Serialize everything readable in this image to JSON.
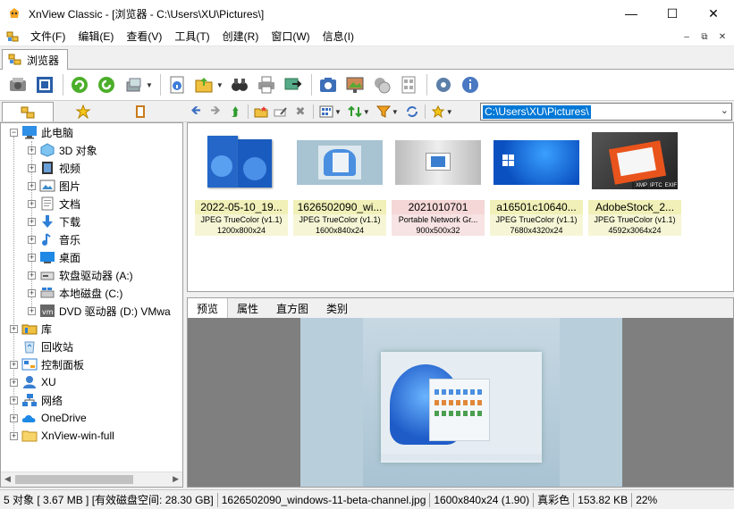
{
  "window": {
    "title": "XnView Classic - [浏览器 - C:\\Users\\XU\\Pictures\\]"
  },
  "menu": {
    "items": [
      "文件(F)",
      "编辑(E)",
      "查看(V)",
      "工具(T)",
      "创建(R)",
      "窗口(W)",
      "信息(I)"
    ]
  },
  "tab": {
    "label": "浏览器"
  },
  "path": {
    "value": "C:\\Users\\XU\\Pictures\\"
  },
  "tree": {
    "items": [
      {
        "label": "此电脑",
        "icon": "computer-icon"
      },
      {
        "label": "3D 对象",
        "icon": "3d-objects-icon"
      },
      {
        "label": "视频",
        "icon": "video-icon"
      },
      {
        "label": "图片",
        "icon": "pictures-icon"
      },
      {
        "label": "文档",
        "icon": "documents-icon"
      },
      {
        "label": "下载",
        "icon": "download-icon"
      },
      {
        "label": "音乐",
        "icon": "music-icon"
      },
      {
        "label": "桌面",
        "icon": "desktop-icon"
      },
      {
        "label": "软盘驱动器 (A:)",
        "icon": "floppy-icon"
      },
      {
        "label": "本地磁盘 (C:)",
        "icon": "disk-icon"
      },
      {
        "label": "DVD 驱动器 (D:) VMwa",
        "icon": "dvd-icon"
      },
      {
        "label": "库",
        "icon": "library-icon"
      },
      {
        "label": "回收站",
        "icon": "recycle-bin-icon"
      },
      {
        "label": "控制面板",
        "icon": "control-panel-icon"
      },
      {
        "label": "XU",
        "icon": "user-icon"
      },
      {
        "label": "网络",
        "icon": "network-icon"
      },
      {
        "label": "OneDrive",
        "icon": "onedrive-icon"
      },
      {
        "label": "XnView-win-full",
        "icon": "folder-icon"
      }
    ]
  },
  "thumbnails": [
    {
      "name": "2022-05-10_19...",
      "type": "JPEG TrueColor (v1.1)",
      "dims": "1200x800x24"
    },
    {
      "name": "1626502090_wi...",
      "type": "JPEG TrueColor (v1.1)",
      "dims": "1600x840x24"
    },
    {
      "name": "2021010701",
      "type": "Portable Network Gr...",
      "dims": "900x500x32"
    },
    {
      "name": "a16501c10640...",
      "type": "JPEG TrueColor (v1.1)",
      "dims": "7680x4320x24"
    },
    {
      "name": "AdobeStock_2...",
      "type": "JPEG TrueColor (v1.1)",
      "dims": "4592x3064x24"
    }
  ],
  "badges": [
    "XMP",
    "IPTC",
    "EXIF"
  ],
  "preview_tabs": [
    "预览",
    "属性",
    "直方图",
    "类别"
  ],
  "status": {
    "count": "5 对象 [ 3.67 MB ] [有效磁盘空间: 28.30 GB]",
    "filename": "1626502090_windows-11-beta-channel.jpg",
    "dims": "1600x840x24 (1.90)",
    "color": "真彩色",
    "size": "153.82 KB",
    "zoom": "22%"
  }
}
